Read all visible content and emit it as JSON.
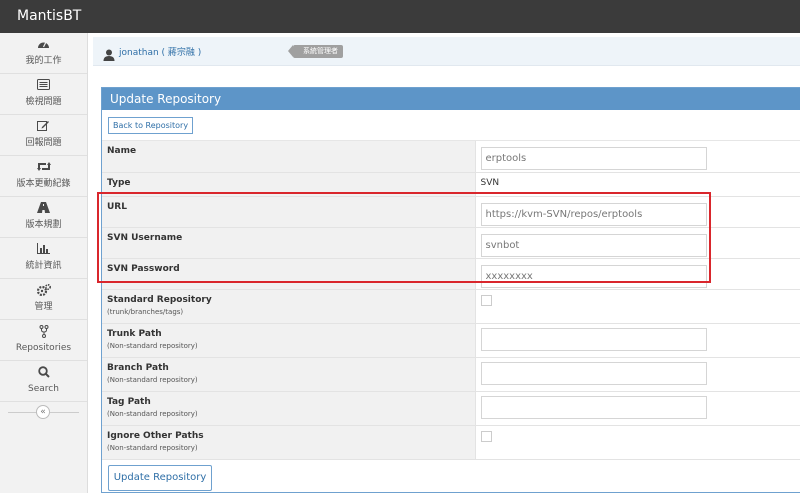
{
  "app": {
    "title": "MantisBT"
  },
  "sidebar": {
    "items": [
      {
        "icon": "dashboard-icon",
        "label": "我的工作"
      },
      {
        "icon": "list-icon",
        "label": "檢視問題"
      },
      {
        "icon": "edit-icon",
        "label": "回報問題"
      },
      {
        "icon": "retweet-icon",
        "label": "版本更動紀錄"
      },
      {
        "icon": "road-icon",
        "label": "版本規劃"
      },
      {
        "icon": "bar-chart-icon",
        "label": "統計資訊"
      },
      {
        "icon": "gears-icon",
        "label": "管理"
      },
      {
        "icon": "code-fork-icon",
        "label": "Repositories"
      },
      {
        "icon": "search-icon",
        "label": "Search"
      }
    ],
    "collapse_icon": "double-angle-left-icon"
  },
  "breadcrumb": {
    "user": "jonathan ( 蔣宗融 )",
    "role": "系統管理者"
  },
  "panel": {
    "title": "Update Repository",
    "back_label": "Back to Repository",
    "fields": {
      "name": {
        "label": "Name",
        "value": "erptools"
      },
      "type": {
        "label": "Type",
        "value": "SVN"
      },
      "url": {
        "label": "URL",
        "value": "https://kvm-SVN/repos/erptools"
      },
      "svn_username": {
        "label": "SVN Username",
        "value": "svnbot"
      },
      "svn_password": {
        "label": "SVN Password",
        "value": "xxxxxxxx"
      },
      "standard_repo": {
        "label": "Standard Repository",
        "sub": "(trunk/branches/tags)",
        "checked": false
      },
      "trunk_path": {
        "label": "Trunk Path",
        "sub": "(Non-standard repository)",
        "value": ""
      },
      "branch_path": {
        "label": "Branch Path",
        "sub": "(Non-standard repository)",
        "value": ""
      },
      "tag_path": {
        "label": "Tag Path",
        "sub": "(Non-standard repository)",
        "value": ""
      },
      "ignore_other": {
        "label": "Ignore Other Paths",
        "sub": "(Non-standard repository)",
        "checked": false
      }
    },
    "submit_label": "Update Repository"
  },
  "colors": {
    "accent": "#5d95c8",
    "highlight": "#d9262c",
    "topbar": "#3b3b3b"
  }
}
